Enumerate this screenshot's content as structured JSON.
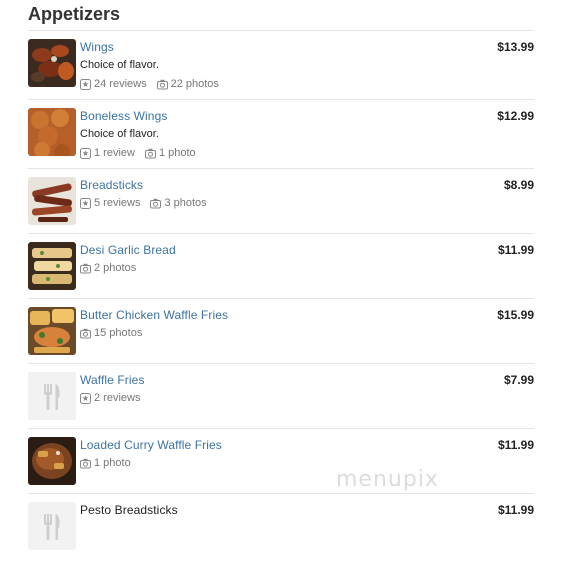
{
  "section": {
    "title": "Appetizers"
  },
  "items": [
    {
      "name": "Wings",
      "description": "Choice of flavor.",
      "reviews": "24 reviews",
      "photos": "22 photos",
      "price": "$13.99",
      "thumb": "wings"
    },
    {
      "name": "Boneless Wings",
      "description": "Choice of flavor.",
      "reviews": "1 review",
      "photos": "1 photo",
      "price": "$12.99",
      "thumb": "boneless"
    },
    {
      "name": "Breadsticks",
      "reviews": "5 reviews",
      "photos": "3 photos",
      "price": "$8.99",
      "thumb": "breadsticks"
    },
    {
      "name": "Desi Garlic Bread",
      "photos": "2 photos",
      "price": "$11.99",
      "thumb": "garlic"
    },
    {
      "name": "Butter Chicken Waffle Fries",
      "photos": "15 photos",
      "price": "$15.99",
      "thumb": "butter"
    },
    {
      "name": "Waffle Fries",
      "reviews": "2 reviews",
      "price": "$7.99",
      "thumb": "placeholder"
    },
    {
      "name": "Loaded Curry Waffle Fries",
      "photos": "1 photo",
      "price": "$11.99",
      "thumb": "curry"
    },
    {
      "name": "Pesto Breadsticks",
      "price": "$11.99",
      "thumb": "placeholder"
    }
  ],
  "watermark": "menupix",
  "icons": {
    "review": "star-badge-icon",
    "photo": "camera-icon",
    "placeholder": "fork-knife-icon"
  }
}
